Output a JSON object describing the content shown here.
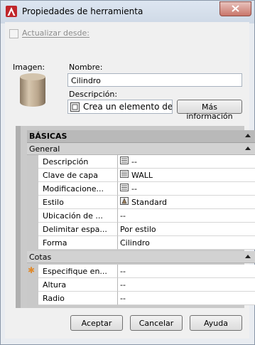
{
  "window": {
    "title": "Propiedades de herramienta"
  },
  "top": {
    "update_from_label": "Actualizar desde:"
  },
  "image": {
    "label": "Imagen:"
  },
  "name": {
    "label": "Nombre:",
    "value": "Cilindro"
  },
  "description": {
    "label": "Descripción:",
    "value": "Crea un elemento de m",
    "more_info_button": "Más información"
  },
  "properties": {
    "category": "BÁSICAS",
    "general": {
      "label": "General",
      "rows": [
        {
          "name": "Descripción",
          "value": "--",
          "icon": "list-icon"
        },
        {
          "name": "Clave de capa",
          "value": "WALL",
          "icon": "list-icon"
        },
        {
          "name": "Modificacione...",
          "value": "--",
          "icon": "list-icon"
        },
        {
          "name": "Estilo",
          "value": "Standard",
          "icon": "style-icon"
        },
        {
          "name": "Ubicación de ...",
          "value": "--"
        },
        {
          "name": "Delimitar espa...",
          "value": "Por estilo"
        },
        {
          "name": "Forma",
          "value": "Cilindro"
        }
      ]
    },
    "dimensions": {
      "label": "Cotas",
      "rows": [
        {
          "name": "Especifique en...",
          "value": "--",
          "required": true
        },
        {
          "name": "Altura",
          "value": "--"
        },
        {
          "name": "Radio",
          "value": "--"
        }
      ]
    }
  },
  "buttons": {
    "ok": "Aceptar",
    "cancel": "Cancelar",
    "help": "Ayuda"
  },
  "colors": {
    "close_button": "#c9756a",
    "accent_required": "#e08a2c",
    "app_icon": "#c0262b"
  }
}
